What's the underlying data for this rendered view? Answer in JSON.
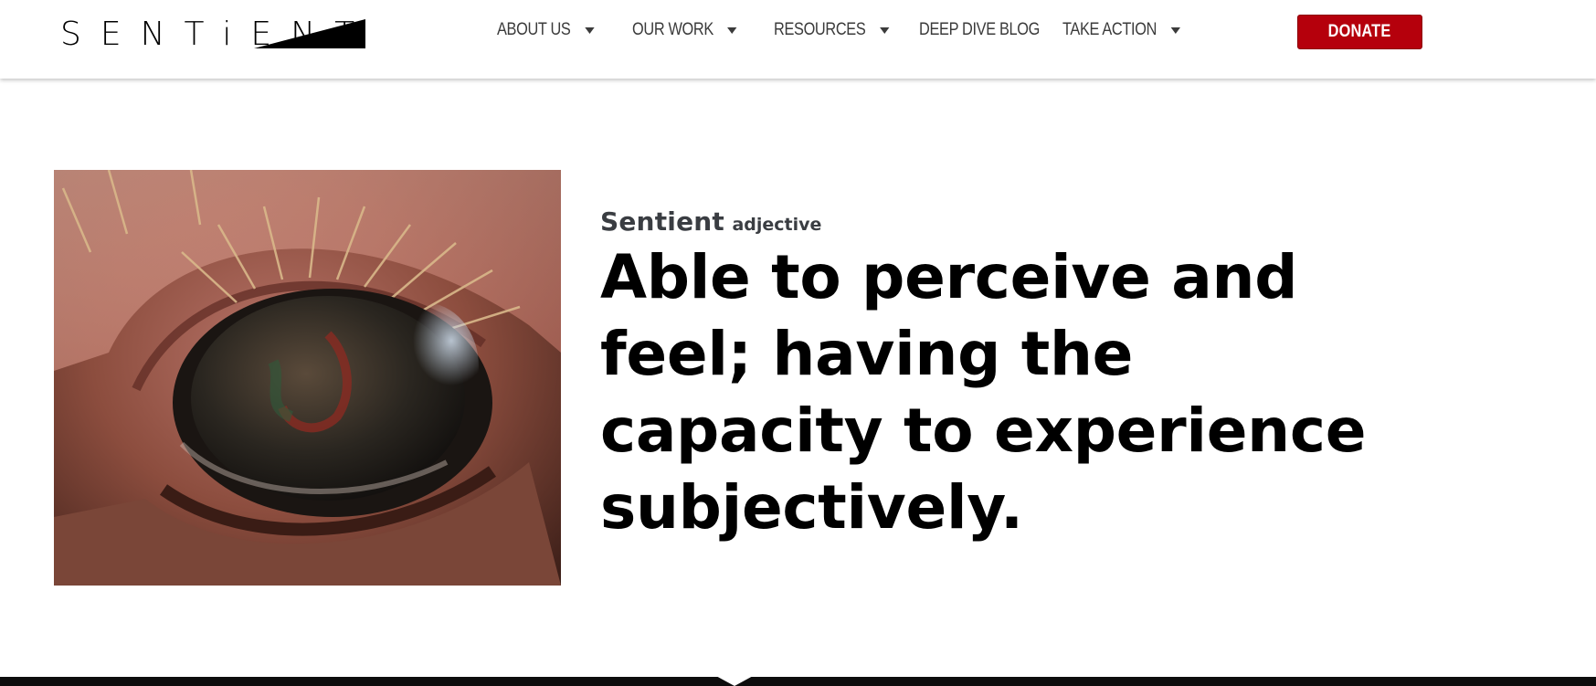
{
  "brand": {
    "logo_text": "SENTiENT",
    "accent_color": "#b5000c"
  },
  "nav": {
    "items": [
      {
        "label": "ABOUT US",
        "has_dropdown": true
      },
      {
        "label": "OUR WORK",
        "has_dropdown": true
      },
      {
        "label": "RESOURCES",
        "has_dropdown": true
      },
      {
        "label": "DEEP DIVE BLOG",
        "has_dropdown": false
      },
      {
        "label": "TAKE ACTION",
        "has_dropdown": true
      }
    ],
    "donate_label": "DONATE"
  },
  "hero": {
    "term": "Sentient",
    "part_of_speech": "adjective",
    "definition": "Able to perceive and feel; having the capacity to experience subjectively."
  }
}
